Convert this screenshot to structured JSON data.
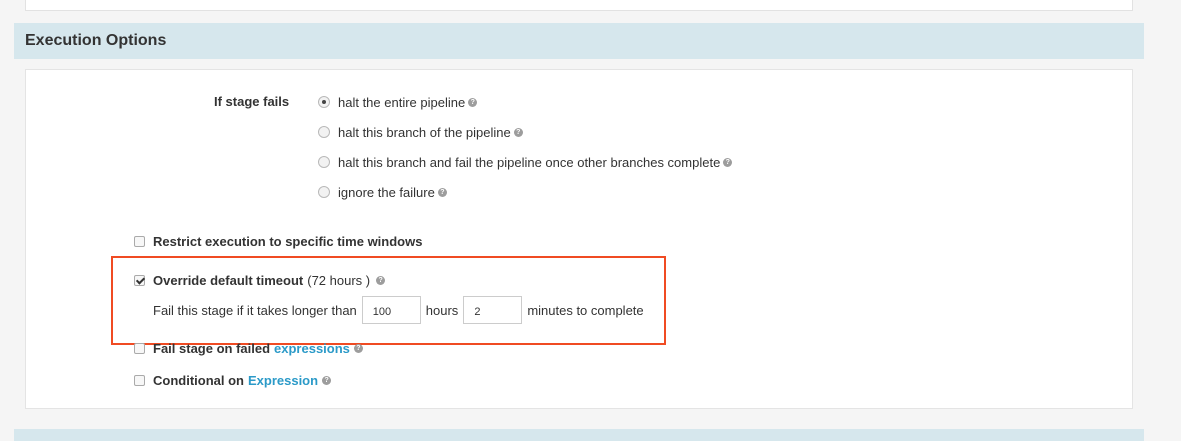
{
  "section": {
    "title": "Execution Options"
  },
  "stage_fails": {
    "label": "If stage fails",
    "options": [
      {
        "label": "halt the entire pipeline",
        "selected": true
      },
      {
        "label": "halt this branch of the pipeline",
        "selected": false
      },
      {
        "label": "halt this branch and fail the pipeline once other branches complete",
        "selected": false
      },
      {
        "label": "ignore the failure",
        "selected": false
      }
    ]
  },
  "restrict": {
    "label": "Restrict execution to specific time windows",
    "checked": false
  },
  "override": {
    "label": "Override default timeout",
    "note": "(72 hours )",
    "checked": true,
    "prefix": "Fail this stage if it takes longer than",
    "hours_value": "100",
    "hours_label": "hours",
    "minutes_value": "2",
    "minutes_label": "minutes to complete"
  },
  "fail_expr": {
    "label": "Fail stage on failed",
    "link": "expressions",
    "checked": false
  },
  "conditional": {
    "label": "Conditional on",
    "link": "Expression",
    "checked": false
  },
  "icons": {
    "help": "question-circle-icon",
    "help_glyph": "?"
  },
  "colors": {
    "header_bg": "#d6e7ed",
    "link": "#2b9ac8",
    "highlight": "#f04b23"
  }
}
